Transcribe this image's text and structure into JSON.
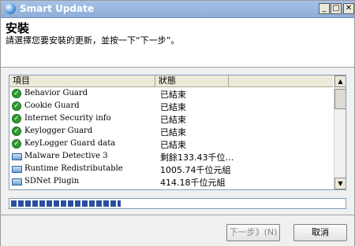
{
  "window": {
    "title": "Smart Update"
  },
  "titlebar": {
    "min": "_",
    "max": "□",
    "close": "✕"
  },
  "header": {
    "title": "安裝",
    "subtitle": "請選擇您要安裝的更新，並按一下“下一步”。"
  },
  "list": {
    "columns": [
      "項目",
      "狀態"
    ],
    "rows": [
      {
        "name": "Behavior Guard",
        "status": "已結束",
        "icon": "check-icon"
      },
      {
        "name": "Cookie Guard",
        "status": "已結束",
        "icon": "check-icon"
      },
      {
        "name": "Internet Security info",
        "status": "已結束",
        "icon": "check-icon"
      },
      {
        "name": "Keylogger Guard",
        "status": "已結束",
        "icon": "check-icon"
      },
      {
        "name": "KeyLogger Guard data",
        "status": "已結束",
        "icon": "check-icon"
      },
      {
        "name": "Malware Detective 3",
        "status": "剩餘133.43千位…",
        "icon": "disk-icon"
      },
      {
        "name": "Runtime Redistributable",
        "status": "1005.74千位元組",
        "icon": "disk-icon"
      },
      {
        "name": "SDNet Plugin",
        "status": "414.18千位元組",
        "icon": "disk-icon"
      }
    ]
  },
  "progress": {
    "percent": 33
  },
  "buttons": {
    "next": "下一步》(N)",
    "cancel": "取消"
  },
  "scrollbar": {
    "up": "▲",
    "down": "▼"
  }
}
